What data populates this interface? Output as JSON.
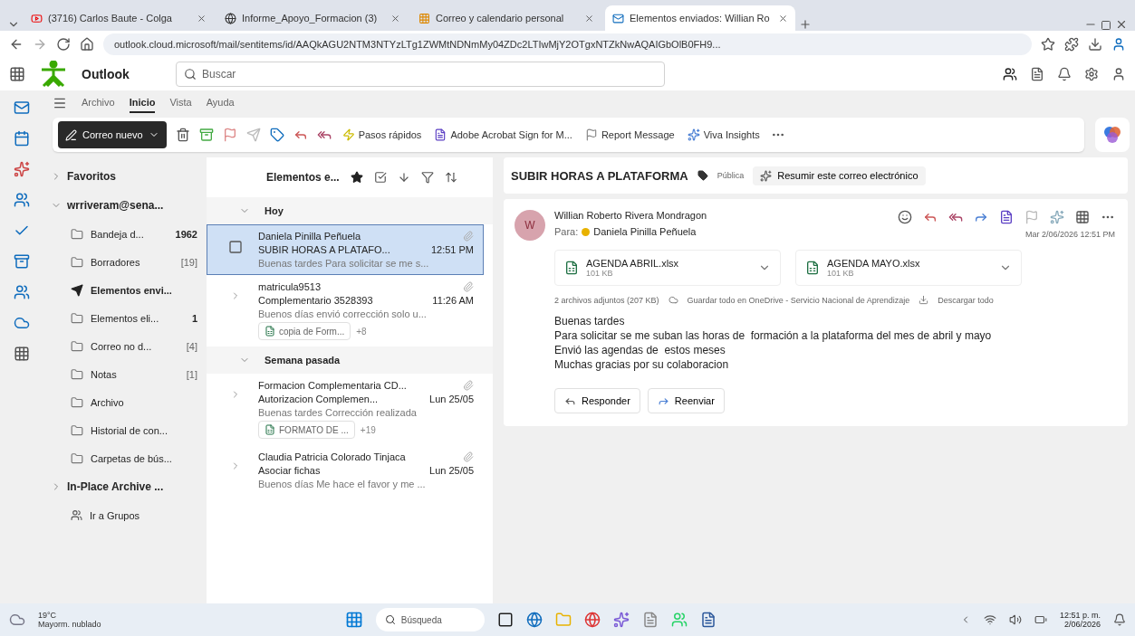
{
  "browser": {
    "tabs": [
      {
        "label": "(3716) Carlos Baute - Colga",
        "selected": false,
        "kind": "video"
      },
      {
        "label": "Informe_Apoyo_Formacion (3)",
        "selected": false,
        "kind": "web"
      },
      {
        "label": "Correo y calendario personal",
        "selected": false,
        "kind": "apps"
      },
      {
        "label": "Elementos enviados: Willian Ro",
        "selected": true,
        "kind": "mail"
      }
    ],
    "url": "outlook.cloud.microsoft/mail/sentitems/id/AAQkAGU2NTM3NTYzLTg1ZWMtNDNmMy04ZDc2LTIwMjY2OTgxNTZkNwAQAIGbOlB0FH9..."
  },
  "header": {
    "app_name": "Outlook",
    "search": {
      "placeholder": "Buscar"
    }
  },
  "ribbon": {
    "tabs": [
      {
        "label": "Archivo",
        "selected": false
      },
      {
        "label": "Inicio",
        "selected": true
      },
      {
        "label": "Vista",
        "selected": false
      },
      {
        "label": "Ayuda",
        "selected": false
      }
    ],
    "new_mail": "Correo nuevo",
    "quick_steps": "Pasos rápidos",
    "acrobat": "Adobe Acrobat Sign for M...",
    "report": "Report Message",
    "insights": "Viva Insights"
  },
  "folders": {
    "favorites": "Favoritos",
    "account": "wrriveram@sena...",
    "items": [
      {
        "label": "Bandeja d...",
        "count": "1962",
        "bold_count": true,
        "selected": false
      },
      {
        "label": "Borradores",
        "count": "[19]",
        "bold_count": false,
        "selected": false
      },
      {
        "label": "Elementos envi...",
        "selected": true
      },
      {
        "label": "Elementos eli...",
        "count": "1",
        "bold_count": true,
        "selected": false
      },
      {
        "label": "Correo no d...",
        "count": "[4]",
        "bold_count": false,
        "selected": false
      },
      {
        "label": "Notas",
        "count": "[1]",
        "bold_count": false,
        "selected": false
      },
      {
        "label": "Archivo",
        "selected": false
      },
      {
        "label": "Historial de con...",
        "selected": false
      },
      {
        "label": "Carpetas de bús...",
        "selected": false
      }
    ],
    "archive": "In-Place Archive ...",
    "groups": "Ir a Grupos"
  },
  "message_list": {
    "title": "Elementos e...",
    "groups": [
      {
        "label": "Hoy",
        "messages": [
          {
            "sender": "Daniela Pinilla Peñuela",
            "subject": "SUBIR HORAS A PLATAFO...",
            "time": "12:51 PM",
            "preview": "Buenas tardes Para solicitar se me s...",
            "selected": true
          },
          {
            "sender": "matricula9513",
            "subject": "Complementario 3528393",
            "time": "11:26 AM",
            "preview": "Buenos días envió corrección solo u...",
            "selected": false,
            "attachment": "copia de Form...",
            "more": "+8"
          }
        ]
      },
      {
        "label": "Semana pasada",
        "messages": [
          {
            "sender": "Formacion Complementaria CD...",
            "subject": "Autorizacion Complemen...",
            "time": "Lun 25/05",
            "preview": "Buenas tardes Corrección realizada",
            "selected": false,
            "attachment": "FORMATO DE ...",
            "more": "+19"
          },
          {
            "sender": "Claudia Patricia Colorado Tinjaca",
            "subject": "Asociar fichas",
            "time": "Lun 25/05",
            "preview": "Buenos días Me hace el favor y me ...",
            "selected": false
          }
        ]
      }
    ]
  },
  "reading": {
    "subject": "SUBIR HORAS A PLATAFORMA",
    "label": "Pública",
    "summarize": "Resumir este correo electrónico",
    "avatar": "W",
    "from": "Willian Roberto Rivera Mondragon",
    "to_label": "Para:",
    "to": "Daniela Pinilla Peñuela",
    "date": "Mar 2/06/2026 12:51 PM",
    "attachments": [
      {
        "name": "AGENDA ABRIL.xlsx",
        "size": "101 KB"
      },
      {
        "name": "AGENDA MAYO.xlsx",
        "size": "101 KB"
      }
    ],
    "attachment_summary": "2 archivos adjuntos (207 KB)",
    "save_all": "Guardar todo en OneDrive - Servicio Nacional de Aprendizaje",
    "download_all": "Descargar todo",
    "body": [
      "Buenas tardes",
      "Para solicitar se me suban las horas de  formación a la plataforma del mes de abril y mayo",
      "Envió las agendas de  estos meses",
      "Muchas gracias por su colaboracion"
    ],
    "reply": "Responder",
    "forward": "Reenviar"
  },
  "taskbar": {
    "temperature": "19°C",
    "weather": "Mayorm. nublado",
    "search": "Búsqueda",
    "time": "12:51 p. m.",
    "date": "2/06/2026"
  }
}
